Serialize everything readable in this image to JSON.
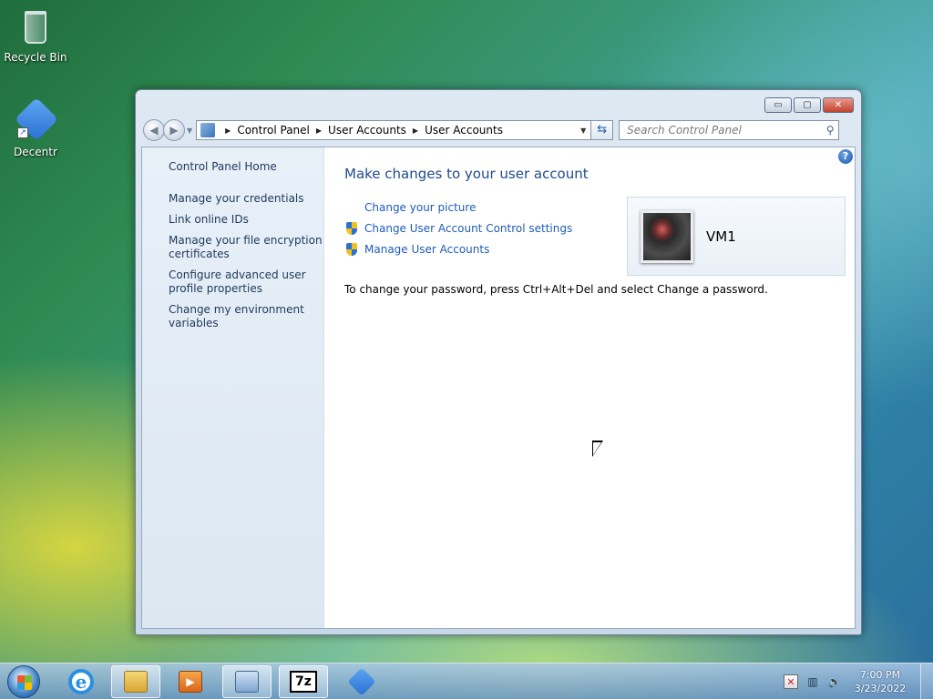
{
  "desktop": {
    "icons": [
      {
        "label": "Recycle Bin",
        "icon": "recycle-bin-icon"
      },
      {
        "label": "Decentr",
        "icon": "decentr-icon"
      }
    ]
  },
  "window": {
    "controls": {
      "minimize": "▭",
      "maximize": "▢",
      "close": "✕"
    },
    "breadcrumb": [
      "Control Panel",
      "User Accounts",
      "User Accounts"
    ],
    "search_placeholder": "Search Control Panel",
    "left_pane": {
      "home": "Control Panel Home",
      "tasks": [
        "Manage your credentials",
        "Link online IDs",
        "Manage your file encryption certificates",
        "Configure advanced user profile properties",
        "Change my environment variables"
      ]
    },
    "main": {
      "title": "Make changes to your user account",
      "links": [
        {
          "label": "Change your picture",
          "icon": "none"
        },
        {
          "label": "Change User Account Control settings",
          "icon": "uac-shield-icon"
        },
        {
          "label": "Manage User Accounts",
          "icon": "uac-shield-icon"
        }
      ],
      "password_note": "To change your password, press Ctrl+Alt+Del and select Change a password.",
      "user": {
        "name": "VM1"
      },
      "help": "?"
    }
  },
  "taskbar": {
    "apps": [
      "internet-explorer-icon",
      "windows-explorer-icon",
      "media-player-icon",
      "control-panel-icon",
      "7zip-icon",
      "decentr-icon"
    ],
    "sevenzip_label": "7z",
    "clock": {
      "time": "7:00 PM",
      "date": "3/23/2022"
    }
  },
  "colors": {
    "link": "#1e5bb8",
    "title": "#1e4b8f",
    "nav_text": "#1e395b"
  }
}
